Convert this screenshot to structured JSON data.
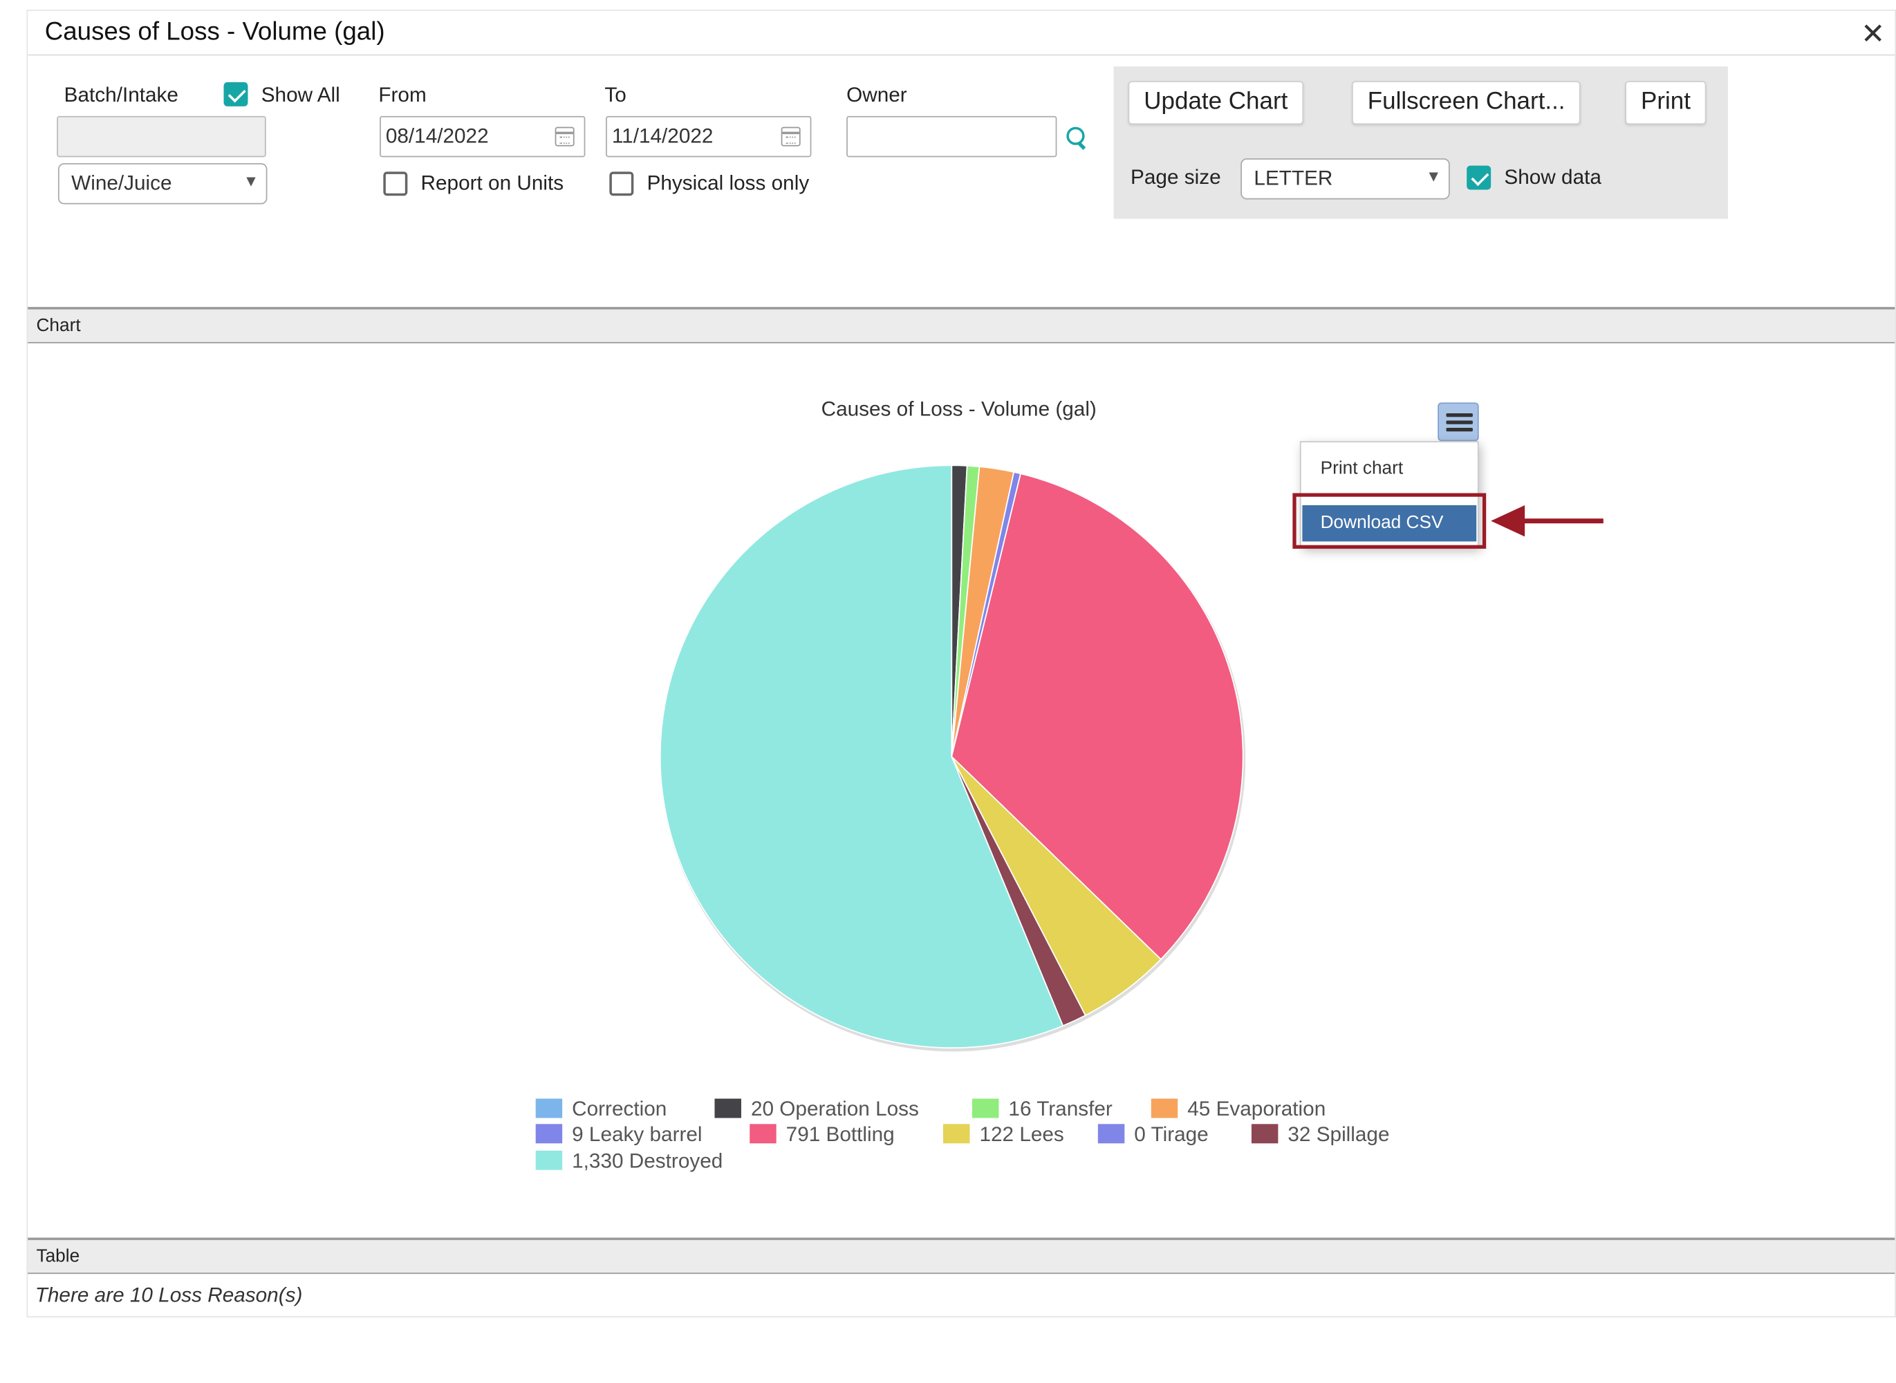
{
  "dialog": {
    "title": "Causes of Loss - Volume (gal)",
    "close_icon": "close-icon"
  },
  "filters": {
    "batch_label": "Batch/Intake",
    "show_all_label": "Show All",
    "show_all_checked": true,
    "batch_value": "",
    "type_select": "Wine/Juice",
    "from_label": "From",
    "from_value": "08/14/2022",
    "to_label": "To",
    "to_value": "11/14/2022",
    "owner_label": "Owner",
    "owner_value": "",
    "report_units_label": "Report on Units",
    "report_units_checked": false,
    "physical_loss_label": "Physical loss only",
    "physical_loss_checked": false
  },
  "toolbar": {
    "update_label": "Update Chart",
    "fullscreen_label": "Fullscreen Chart...",
    "print_label": "Print",
    "page_size_label": "Page size",
    "page_size_value": "LETTER",
    "show_data_label": "Show data",
    "show_data_checked": true
  },
  "sections": {
    "chart_label": "Chart",
    "table_label": "Table",
    "table_note": "There are 10 Loss Reason(s)"
  },
  "chart_menu": {
    "print_label": "Print chart",
    "download_label": "Download CSV"
  },
  "chart_data": {
    "type": "pie",
    "title": "Causes of Loss - Volume (gal)",
    "legend_placement": "bottom",
    "slices": [
      {
        "name": "Correction",
        "label": "Correction",
        "value": 0,
        "color": "#7cb5ec"
      },
      {
        "name": "Operation Loss",
        "label": "20 Operation Loss",
        "value": 20,
        "color": "#434348"
      },
      {
        "name": "Transfer",
        "label": "16 Transfer",
        "value": 16,
        "color": "#90ed7d"
      },
      {
        "name": "Evaporation",
        "label": "45 Evaporation",
        "value": 45,
        "color": "#f7a35c"
      },
      {
        "name": "Leaky barrel",
        "label": "9 Leaky barrel",
        "value": 9,
        "color": "#8085e9"
      },
      {
        "name": "Bottling",
        "label": "791 Bottling",
        "value": 791,
        "color": "#f15c80"
      },
      {
        "name": "Lees",
        "label": "122 Lees",
        "value": 122,
        "color": "#e4d354"
      },
      {
        "name": "Tirage",
        "label": "0 Tirage",
        "value": 0,
        "color": "#8085e8"
      },
      {
        "name": "Spillage",
        "label": "32 Spillage",
        "value": 32,
        "color": "#8d4653"
      },
      {
        "name": "Destroyed",
        "label": "1,330 Destroyed",
        "value": 1330,
        "color": "#91e8e1"
      }
    ]
  },
  "annotation": {
    "arrow_color": "#9b1b26"
  }
}
